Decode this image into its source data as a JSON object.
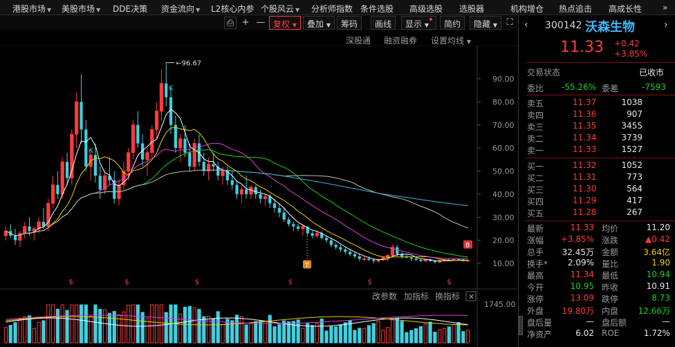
{
  "topnav": {
    "items": [
      {
        "label": "港股市场",
        "dd": true
      },
      {
        "label": "美股市场",
        "dd": true
      },
      {
        "label": "DDE决策",
        "dd": false
      },
      {
        "label": "资金流向",
        "dd": true
      },
      {
        "label": "L2核心内参",
        "dd": false
      },
      {
        "label": "个股风云",
        "dd": true
      },
      {
        "label": "分析师指数",
        "dd": false
      },
      {
        "label": "条件选股",
        "dd": false
      },
      {
        "label": "高级选股",
        "dd": false
      },
      {
        "label": "选股器",
        "dd": false
      },
      {
        "label": "机构增仓",
        "dd": false
      },
      {
        "label": "热点追击",
        "dd": false
      },
      {
        "label": "高成长性",
        "dd": false
      }
    ]
  },
  "toolbar": {
    "fuquan": "复权",
    "diejia": "叠加",
    "choumа": "筹码",
    "huaxian": "画线",
    "xianshi": "显示",
    "jianyue": "简约",
    "yincang": "隐藏",
    "plus": "+",
    "minus": "—",
    "close_icon": "✕"
  },
  "subbar": {
    "shengu": "深股通",
    "rongzi": "融资融券",
    "junxian": "设置均线"
  },
  "indicator_bar": {
    "gaicanshu": "改参数",
    "jiazhibiao": "加指标",
    "huanzhibiao": "换指标"
  },
  "chart_data": {
    "type": "candlestick",
    "y_ticks": [
      "90.00",
      "80.00",
      "70.00",
      "60.00",
      "50.00",
      "40.00",
      "30.00",
      "20.00",
      "10.00"
    ],
    "ylim": [
      5,
      100
    ],
    "peak_label": "96.67",
    "volume_tick": "1745.00",
    "candles": [
      [
        22,
        26,
        20,
        24
      ],
      [
        24,
        27,
        21,
        22
      ],
      [
        22,
        25,
        18,
        20
      ],
      [
        20,
        24,
        17,
        23
      ],
      [
        23,
        28,
        21,
        26
      ],
      [
        26,
        30,
        22,
        24
      ],
      [
        24,
        26,
        20,
        25
      ],
      [
        25,
        30,
        23,
        28
      ],
      [
        28,
        34,
        25,
        26
      ],
      [
        26,
        38,
        24,
        36
      ],
      [
        36,
        48,
        34,
        44
      ],
      [
        44,
        50,
        38,
        40
      ],
      [
        40,
        56,
        38,
        54
      ],
      [
        54,
        58,
        44,
        47
      ],
      [
        47,
        68,
        44,
        66
      ],
      [
        66,
        84,
        60,
        80
      ],
      [
        80,
        92,
        62,
        68
      ],
      [
        68,
        72,
        50,
        52
      ],
      [
        52,
        58,
        46,
        57
      ],
      [
        57,
        62,
        45,
        48
      ],
      [
        48,
        52,
        38,
        42
      ],
      [
        42,
        50,
        40,
        48
      ],
      [
        48,
        56,
        44,
        46
      ],
      [
        46,
        50,
        36,
        38
      ],
      [
        38,
        46,
        35,
        44
      ],
      [
        44,
        54,
        42,
        50
      ],
      [
        50,
        60,
        46,
        58
      ],
      [
        58,
        72,
        55,
        70
      ],
      [
        70,
        76,
        60,
        62
      ],
      [
        62,
        66,
        52,
        55
      ],
      [
        55,
        60,
        48,
        58
      ],
      [
        58,
        70,
        56,
        68
      ],
      [
        68,
        80,
        64,
        76
      ],
      [
        76,
        94,
        72,
        88
      ],
      [
        88,
        97,
        78,
        82
      ],
      [
        82,
        86,
        66,
        70
      ],
      [
        70,
        74,
        58,
        60
      ],
      [
        60,
        66,
        54,
        64
      ],
      [
        64,
        70,
        56,
        58
      ],
      [
        58,
        62,
        50,
        52
      ],
      [
        52,
        64,
        50,
        62
      ],
      [
        62,
        66,
        52,
        54
      ],
      [
        54,
        58,
        48,
        50
      ],
      [
        50,
        56,
        46,
        53
      ],
      [
        53,
        58,
        50,
        52
      ],
      [
        52,
        54,
        46,
        48
      ],
      [
        48,
        52,
        44,
        50
      ],
      [
        50,
        52,
        44,
        46
      ],
      [
        46,
        50,
        42,
        44
      ],
      [
        44,
        46,
        38,
        40
      ],
      [
        40,
        44,
        36,
        42
      ],
      [
        42,
        48,
        38,
        40
      ],
      [
        40,
        44,
        38,
        43
      ],
      [
        43,
        44,
        38,
        40
      ],
      [
        40,
        42,
        36,
        38
      ],
      [
        38,
        40,
        35,
        39
      ],
      [
        39,
        40,
        34,
        36
      ],
      [
        36,
        38,
        32,
        34
      ],
      [
        34,
        36,
        30,
        32
      ],
      [
        32,
        34,
        28,
        29
      ],
      [
        29,
        30,
        26,
        27
      ],
      [
        27,
        28,
        24,
        26
      ],
      [
        26,
        27,
        24,
        25
      ],
      [
        25,
        27,
        22,
        26
      ],
      [
        26,
        26,
        22,
        23
      ],
      [
        23,
        24,
        21,
        22
      ],
      [
        22,
        24,
        21,
        23
      ],
      [
        23,
        24,
        20,
        21
      ],
      [
        21,
        22,
        19,
        20
      ],
      [
        20,
        21,
        17,
        18
      ],
      [
        18,
        19,
        16,
        17
      ],
      [
        17,
        18,
        15,
        16
      ],
      [
        16,
        17,
        14,
        15
      ],
      [
        15,
        16,
        13,
        14
      ],
      [
        14,
        15,
        12,
        13
      ],
      [
        13,
        14,
        11,
        12
      ],
      [
        12,
        13,
        11,
        12
      ],
      [
        12,
        13,
        11,
        11.5
      ],
      [
        11.5,
        12,
        10,
        11
      ],
      [
        11,
        12,
        10,
        11.5
      ],
      [
        11.5,
        13,
        11,
        12.5
      ],
      [
        12.5,
        14,
        11,
        13.5
      ],
      [
        13.5,
        18,
        13,
        17
      ],
      [
        17,
        18,
        13,
        14
      ],
      [
        14,
        15,
        12,
        13
      ],
      [
        13,
        14,
        12,
        12.5
      ],
      [
        12.5,
        13,
        11,
        12
      ],
      [
        12,
        12.5,
        11,
        11.5
      ],
      [
        11.5,
        12,
        10.5,
        11
      ],
      [
        11,
        12,
        10.5,
        11.8
      ],
      [
        11.8,
        12,
        10.8,
        11
      ],
      [
        11,
        11.5,
        10,
        10.5
      ],
      [
        10.5,
        11.5,
        10.2,
        11.2
      ],
      [
        11.2,
        12,
        10.8,
        11.5
      ],
      [
        11.5,
        12,
        11,
        11.4
      ],
      [
        11.4,
        12,
        11,
        11.7
      ],
      [
        11.7,
        12.2,
        11.2,
        11.5
      ],
      [
        11.5,
        12,
        10.9,
        10.95
      ],
      [
        10.95,
        11.4,
        10.9,
        11.33
      ]
    ],
    "ma_colors": [
      "#ffffff",
      "#f0d000",
      "#e040e0",
      "#20d020",
      "#c0c0c0",
      "#3fb6d8"
    ],
    "markers": {
      "T": "T",
      "B": "B",
      "K": "K",
      "D": "b",
      "S": "$"
    }
  },
  "quote": {
    "code": "300142",
    "name": "沃森生物",
    "price": "11.33",
    "change": "+0.42",
    "pct": "+3.85%",
    "status_label": "交易状态",
    "status_value": "已收市",
    "weibi_label": "委比",
    "weibi_value": "-55.26%",
    "weicha_label": "委差",
    "weicha_value": "-7593",
    "asks": [
      {
        "label": "卖五",
        "price": "11.37",
        "vol": "1038"
      },
      {
        "label": "卖四",
        "price": "11.36",
        "vol": "907"
      },
      {
        "label": "卖三",
        "price": "11.35",
        "vol": "3455"
      },
      {
        "label": "卖二",
        "price": "11.34",
        "vol": "3739"
      },
      {
        "label": "卖一",
        "price": "11.33",
        "vol": "1527"
      }
    ],
    "bids": [
      {
        "label": "买一",
        "price": "11.32",
        "vol": "1052"
      },
      {
        "label": "买二",
        "price": "11.31",
        "vol": "773"
      },
      {
        "label": "买三",
        "price": "11.30",
        "vol": "564"
      },
      {
        "label": "买四",
        "price": "11.29",
        "vol": "417"
      },
      {
        "label": "买五",
        "price": "11.28",
        "vol": "267"
      }
    ],
    "stats": [
      {
        "l1": "最新",
        "v1": "11.33",
        "c1": "red",
        "l2": "均价",
        "v2": "11.20",
        "c2": "white"
      },
      {
        "l1": "涨幅",
        "v1": "+3.85%",
        "c1": "red",
        "l2": "涨跌",
        "v2": "▲0.42",
        "c2": "red"
      },
      {
        "l1": "总手",
        "v1": "32.45万",
        "c1": "white",
        "l2": "金额",
        "v2": "3.64亿",
        "c2": "yellow"
      },
      {
        "l1": "换手*",
        "v1": "2.09%",
        "c1": "white",
        "l2": "量比",
        "v2": "1.90",
        "c2": "yellow"
      },
      {
        "l1": "最高",
        "v1": "11.34",
        "c1": "red",
        "l2": "最低",
        "v2": "10.94",
        "c2": "green"
      },
      {
        "l1": "今开",
        "v1": "10.95",
        "c1": "green",
        "l2": "昨收",
        "v2": "10.91",
        "c2": "white"
      },
      {
        "l1": "涨停",
        "v1": "13.09",
        "c1": "red",
        "l2": "跌停",
        "v2": "8.73",
        "c2": "green"
      },
      {
        "l1": "外盘",
        "v1": "19.80万",
        "c1": "red",
        "l2": "内盘",
        "v2": "12.66万",
        "c2": "green"
      },
      {
        "l1": "盘后量",
        "v1": "—",
        "c1": "white",
        "l2": "盘后额",
        "v2": "—",
        "c2": "white"
      },
      {
        "l1": "净资产",
        "v1": "6.02",
        "c1": "white",
        "l2": "ROE",
        "v2": "1.72%",
        "c2": "white"
      }
    ]
  }
}
